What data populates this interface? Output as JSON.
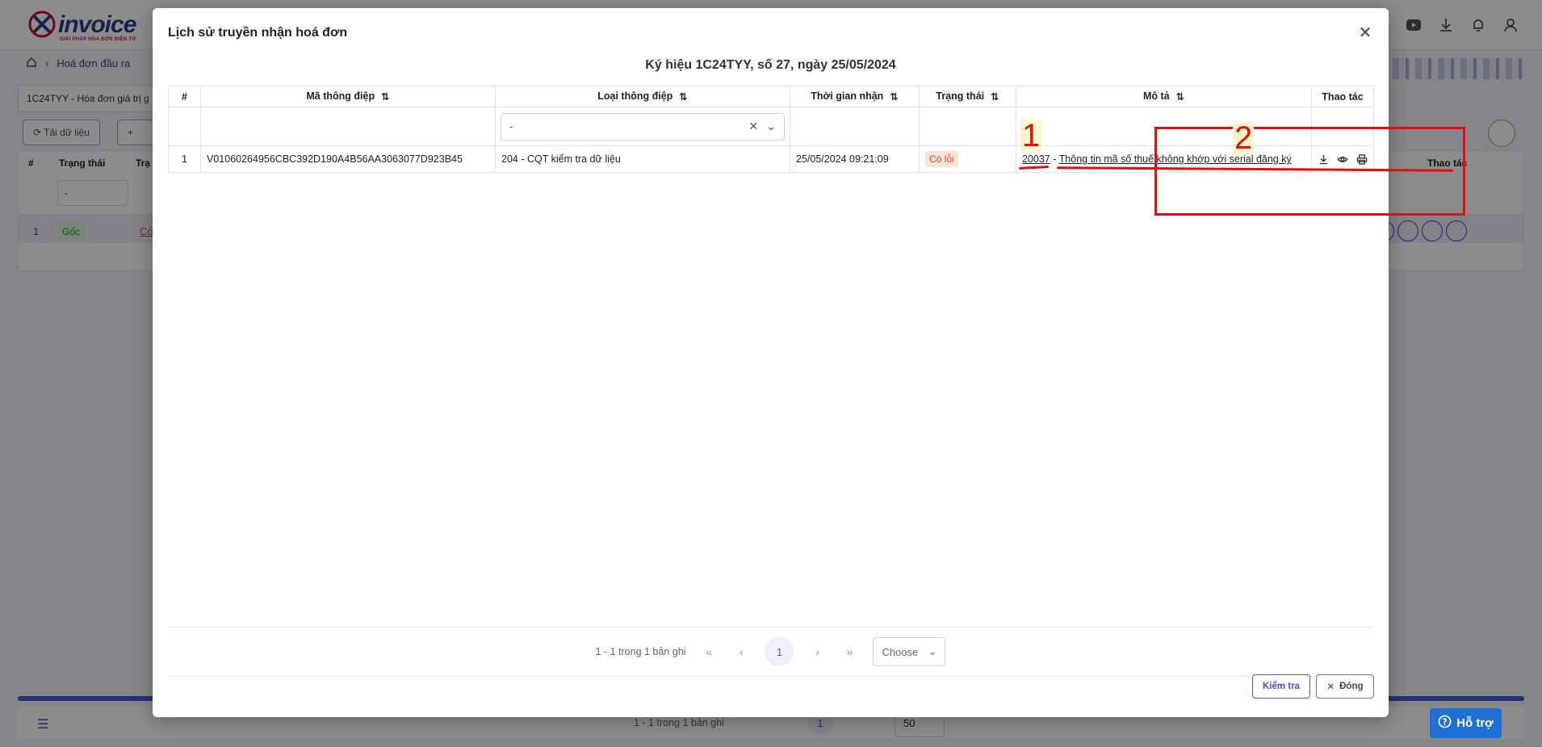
{
  "app": {
    "logo_text": "invoice",
    "logo_sub": "GIẢI PHÁP HÓA ĐƠN ĐIỆN TỬ",
    "breadcrumb": "Hoá đơn đầu ra",
    "series_select": "1C24TYY - Hóa đơn giá trị g",
    "reload_button": "Tải dữ liệu",
    "bg_col_index": "#",
    "bg_col_status": "Trạng thái",
    "bg_col_status2": "Trạ",
    "bg_col_actions": "Thao tác",
    "bg_filter_value": "-",
    "bg_row_index": "1",
    "bg_row_status": "Gốc",
    "bg_row_status2": "Có",
    "bg_pager_text": "1 - 1 trong 1 bản ghi",
    "bg_pager_page": "1",
    "bg_pager_size": "50",
    "help_button": "Hỗ trợ"
  },
  "modal": {
    "title": "Lịch sử truyền nhận hoá đơn",
    "subtitle": "Ký hiệu 1C24TYY, số 27, ngày 25/05/2024",
    "columns": {
      "index": "#",
      "message_code": "Mã thông điệp",
      "message_type": "Loại thông điệp",
      "received_time": "Thời gian nhận",
      "status": "Trạng thái",
      "description": "Mô tả",
      "actions": "Thao tác"
    },
    "filter": {
      "message_type_value": "-"
    },
    "rows": [
      {
        "index": "1",
        "message_code": "V01060264956CBC392D190A4B56AA3063077D923B45",
        "message_type": "204 - CQT kiểm tra dữ liệu",
        "received_time": "25/05/2024 09:21:09",
        "status": "Có lỗi",
        "desc_code": "20037",
        "desc_sep": " - ",
        "desc_text": "Thông tin mã số thuế không khớp với serial đăng ký"
      }
    ],
    "annotations": {
      "one": "1",
      "two": "2"
    },
    "pager": {
      "summary": "1 - 1 trong 1 bản ghi",
      "current_page": "1",
      "page_size_placeholder": "Choose"
    },
    "check_button": "Kiểm tra",
    "close_button": "Đóng"
  },
  "colors": {
    "accent": "#4a58c6",
    "error": "#d9482b",
    "annotation": "#e01010"
  }
}
